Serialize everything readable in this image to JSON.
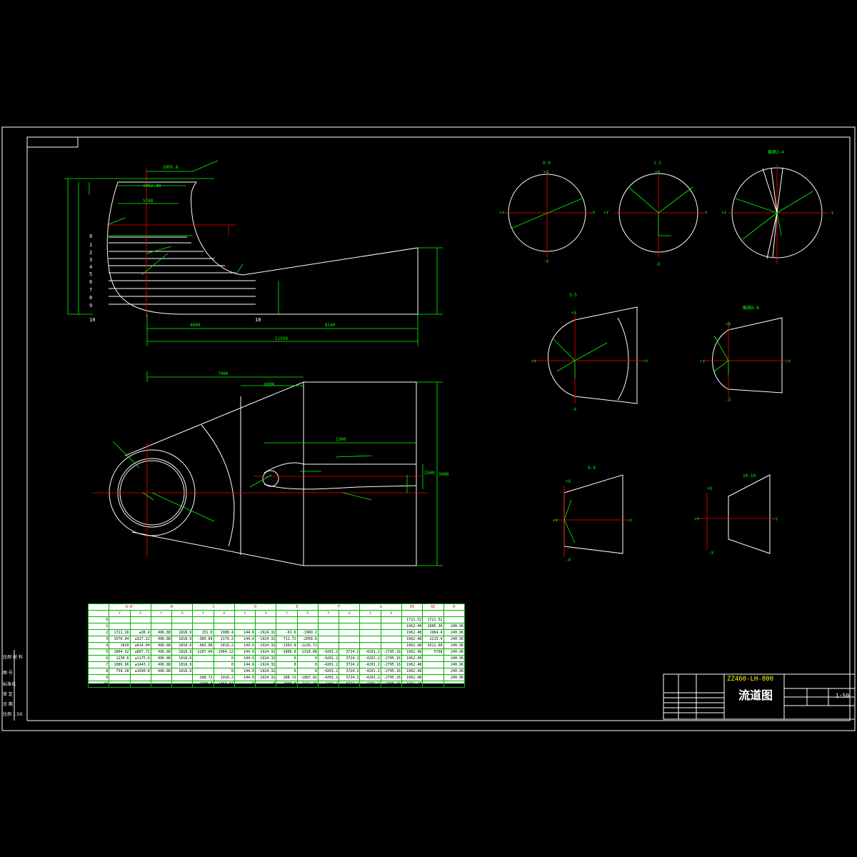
{
  "title_block": {
    "drawing_number": "ZZ460-LH-800",
    "drawing_title": "流道图",
    "scale": "1:50"
  },
  "sections": [
    {
      "id": "sec-0",
      "label": "0-0"
    },
    {
      "id": "sec-1",
      "label": "1-1"
    },
    {
      "id": "sec-2",
      "label": "截面2-4"
    },
    {
      "id": "sec-5",
      "label": "5-5"
    },
    {
      "id": "sec-6",
      "label": "截面6-8"
    },
    {
      "id": "sec-9",
      "label": "9-9"
    },
    {
      "id": "sec-10",
      "label": "10-10"
    }
  ],
  "axis_labels": {
    "plus_x": "+X",
    "minus_x": "-X",
    "plus_y": "+Y",
    "minus_y": "-Y"
  },
  "section_numbers": [
    "0",
    "1",
    "2",
    "3",
    "4",
    "5",
    "6",
    "7",
    "8",
    "9",
    "10"
  ],
  "table": {
    "groups": [
      "",
      "A-A'",
      "B",
      "C",
      "D",
      "E",
      "F",
      "G",
      "H1",
      "H2",
      "R"
    ],
    "sub": [
      "",
      "Y",
      "X",
      "Y",
      "X",
      "Y",
      "X",
      "Y",
      "X",
      "Y",
      "X",
      "Y",
      "X",
      "Y",
      "X",
      "",
      "",
      ""
    ],
    "rows": [
      [
        "0",
        "",
        "",
        "",
        "",
        "",
        "",
        "",
        "",
        "",
        "",
        "",
        "",
        "",
        "",
        "1721.52",
        "1721.52",
        ""
      ],
      [
        "1",
        "",
        "",
        "",
        "",
        "",
        "",
        "",
        "",
        "",
        "",
        "",
        "",
        "",
        "",
        "1962.48",
        "1606.36",
        "240.96"
      ],
      [
        "2",
        "1721.16",
        "±38.4",
        "496.88",
        "1818.6",
        "151.8",
        "1988.4",
        "144.6",
        "-1924.32",
        "-61.6",
        "-1960.2",
        "",
        "",
        "",
        "",
        "1962.48",
        "1964.4",
        "240.96"
      ],
      [
        "3",
        "1570.04",
        "±327.12",
        "496.88",
        "1818.6",
        "-380.84",
        "2179.2",
        "144.6",
        "-1924.32",
        "-711.72",
        "-2058.6",
        "",
        "",
        "",
        "",
        "1962.48",
        "2213.4",
        "240.96"
      ],
      [
        "4",
        "1620",
        "±614.04",
        "496.88",
        "1818.6",
        "-983.88",
        "2419.2",
        "144.6",
        "-1924.32",
        "-1363.8",
        "-2226.72",
        "",
        "",
        "",
        "",
        "1962.48",
        "2611.68",
        "240.96"
      ],
      [
        "5",
        "1804.32",
        "±897.72",
        "496.88",
        "1818.6",
        "-2287.04",
        "2964.12",
        "144.6",
        "-1924.32",
        "-2806.6",
        "-2318.88",
        "-4201.2",
        "3724.2",
        "-4201.2",
        "-2795.16",
        "1962.48",
        "5768",
        "240.96"
      ],
      [
        "6",
        "1230.6",
        "±1175.6",
        "496.88",
        "1818.6",
        "",
        "0",
        "144.6",
        "-1924.32",
        "0",
        "0",
        "-4201.2",
        "3724.2",
        "-4201.2",
        "-2795.16",
        "1962.48",
        "",
        "240.96"
      ],
      [
        "7",
        "1089.96",
        "±1443.1",
        "496.88",
        "1818.6",
        "",
        "0",
        "144.6",
        "-1924.32",
        "0",
        "0",
        "-4201.2",
        "3724.2",
        "-4201.2",
        "-2795.16",
        "1962.48",
        "",
        "240.96"
      ],
      [
        "8",
        "759.28",
        "±1690.8",
        "496.88",
        "1818.6",
        "",
        "0",
        "144.6",
        "-1924.32",
        "0",
        "0",
        "-4201.2",
        "3724.2",
        "-4201.2",
        "-2795.16",
        "1962.48",
        "",
        "240.96"
      ],
      [
        "9",
        "",
        "",
        "",
        "",
        "288.72",
        "1916.2",
        "144.6",
        "-1924.32",
        "288.72",
        "-1887.92",
        "-4201.2",
        "3724.2",
        "-4201.2",
        "-2795.16",
        "1962.48",
        "",
        "240.96"
      ],
      [
        "10",
        "",
        "",
        "",
        "",
        "-1095.8",
        "2463.84",
        "0",
        "0",
        "-1095.8",
        "-2172.48",
        "-4201.2",
        "3724.2",
        "-4201.2",
        "-2795.16",
        "1962.48",
        "",
        ""
      ]
    ]
  },
  "dimensions": {
    "d1": "2005.8",
    "d2": "1962.48",
    "d3": "5768",
    "d4": "4800",
    "d5": "8140",
    "d6": "11920",
    "d7": "7900",
    "d8": "6000",
    "d9": "1300",
    "d10": "3000",
    "d11": "2500"
  },
  "left_labels": [
    "比例 材 料",
    "图 号",
    "标准化",
    "审 定",
    "日 期",
    "比例 1:50"
  ]
}
